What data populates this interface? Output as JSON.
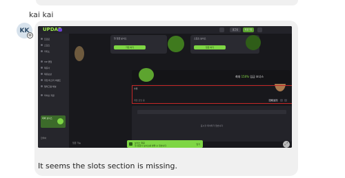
{
  "message": {
    "sender": "kai kai",
    "avatar_initials": "KK",
    "caption": "It seems the slots section is missing."
  },
  "app": {
    "logo": "UPDAP",
    "header": {
      "login": "로그인",
      "register": "회원가입"
    },
    "sidebar": {
      "items": [
        "프로모",
        "스포츠",
        "카지노",
        "VIP 클럽",
        "제휴사",
        "제휴보상",
        "추천 마스터 이벤트",
        "텔레그램 채널",
        "라이브 지원"
      ],
      "promo_label": "대박 보너스",
      "bottom_label": "한국어"
    },
    "promos": [
      {
        "text": "첫 입금 보너스",
        "button": "가입 하기"
      },
      {
        "text": "스포츠 보너스",
        "button": "입금 하기"
      }
    ],
    "banner": {
      "prefix": "최대 ",
      "accent": "150%",
      "suffix": " 입금 보너스"
    },
    "slots": {
      "label": "슬롯",
      "sub_label": "게임 로딩 중",
      "btn_all": "전체 보기"
    },
    "empty_text": "표시할 데이터가 없습니다",
    "footer_label": "입금 가능",
    "toast": {
      "title": "보너스 알림",
      "body": "첫 입금시 보너스를 받을 수 있습니다",
      "close": "닫기"
    }
  },
  "colors": {
    "accent": "#7ed644",
    "highlight": "#c62828",
    "dark_bg": "#1d1d22"
  }
}
